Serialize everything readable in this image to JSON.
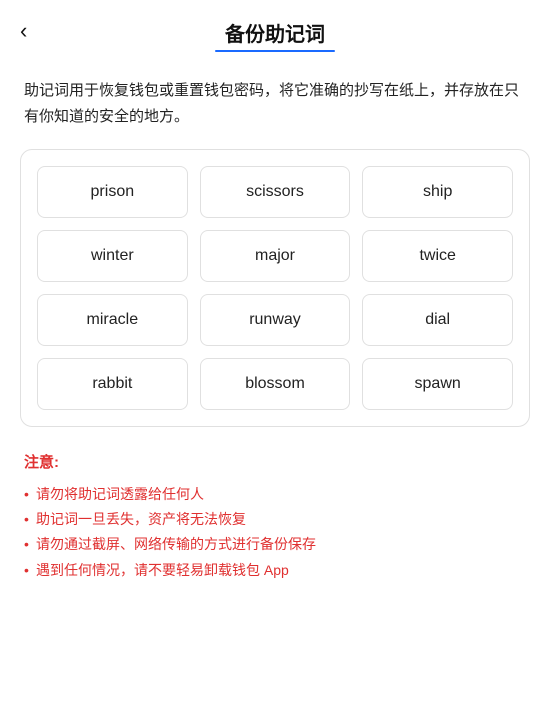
{
  "header": {
    "back_label": "‹",
    "title": "备份助记词",
    "underline_color": "#1a6aff"
  },
  "description": "助记词用于恢复钱包或重置钱包密码，将它准确的抄写在纸上，并存放在只有你知道的安全的地方。",
  "mnemonic": {
    "words": [
      "prison",
      "scissors",
      "ship",
      "winter",
      "major",
      "twice",
      "miracle",
      "runway",
      "dial",
      "rabbit",
      "blossom",
      "spawn"
    ]
  },
  "notice": {
    "title": "注意:",
    "items": [
      "请勿将助记词透露给任何人",
      "助记词一旦丢失，资产将无法恢复",
      "请勿通过截屏、网络传输的方式进行备份保存",
      "遇到任何情况，请不要轻易卸载钱包 App"
    ]
  }
}
